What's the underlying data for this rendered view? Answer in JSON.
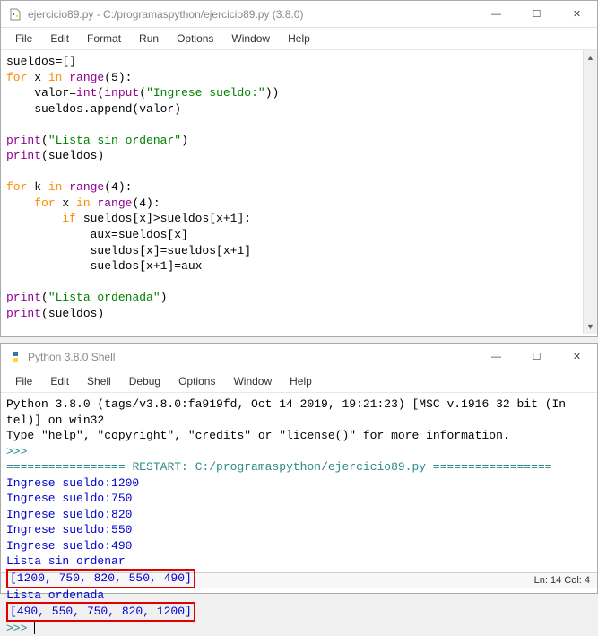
{
  "editor": {
    "title": "ejercicio89.py - C:/programaspython/ejercicio89.py (3.8.0)",
    "menus": [
      "File",
      "Edit",
      "Format",
      "Run",
      "Options",
      "Window",
      "Help"
    ],
    "code": {
      "l1": {
        "a": "sueldos=[]"
      },
      "l2": {
        "a": "for",
        "b": " x ",
        "c": "in",
        "d": " range",
        "e": "(5):"
      },
      "l3": {
        "a": "    valor=",
        "b": "int",
        "c": "(",
        "d": "input",
        "e": "(",
        "f": "\"Ingrese sueldo:\"",
        "g": "))"
      },
      "l4": {
        "a": "    sueldos.append(valor)"
      },
      "l5": {
        "a": ""
      },
      "l6": {
        "a": "print",
        "b": "(",
        "c": "\"Lista sin ordenar\"",
        "d": ")"
      },
      "l7": {
        "a": "print",
        "b": "(sueldos)"
      },
      "l8": {
        "a": ""
      },
      "l9": {
        "a": "for",
        "b": " k ",
        "c": "in",
        "d": " range",
        "e": "(4):"
      },
      "l10": {
        "a": "    ",
        "b": "for",
        "c": " x ",
        "d": "in",
        "e": " range",
        "f": "(4):"
      },
      "l11": {
        "a": "        ",
        "b": "if",
        "c": " sueldos[x]>sueldos[x+1]:"
      },
      "l12": {
        "a": "            aux=sueldos[x]"
      },
      "l13": {
        "a": "            sueldos[x]=sueldos[x+1]"
      },
      "l14": {
        "a": "            sueldos[x+1]=aux"
      },
      "l15": {
        "a": ""
      },
      "l16": {
        "a": "print",
        "b": "(",
        "c": "\"Lista ordenada\"",
        "d": ")"
      },
      "l17": {
        "a": "print",
        "b": "(sueldos)"
      }
    }
  },
  "shell": {
    "title": "Python 3.8.0 Shell",
    "menus": [
      "File",
      "Edit",
      "Shell",
      "Debug",
      "Options",
      "Window",
      "Help"
    ],
    "lines": {
      "l1": "Python 3.8.0 (tags/v3.8.0:fa919fd, Oct 14 2019, 19:21:23) [MSC v.1916 32 bit (In",
      "l2": "tel)] on win32",
      "l3": "Type \"help\", \"copyright\", \"credits\" or \"license()\" for more information.",
      "l4": ">>>",
      "l5a": "================= ",
      "l5b": "RESTART: C:/programaspython/ejercicio89.py",
      "l5c": " =================",
      "l6": "Ingrese sueldo:1200",
      "l7": "Ingrese sueldo:750",
      "l8": "Ingrese sueldo:820",
      "l9": "Ingrese sueldo:550",
      "l10": "Ingrese sueldo:490",
      "l11": "Lista sin ordenar",
      "l12": "[1200, 750, 820, 550, 490]",
      "l13": "Lista ordenada",
      "l14": "[490, 550, 750, 820, 1200]",
      "l15": ">>> "
    },
    "status": "Ln: 14  Col: 4"
  },
  "icons": {
    "min": "—",
    "max": "☐",
    "close": "✕",
    "up": "▲",
    "down": "▼"
  }
}
